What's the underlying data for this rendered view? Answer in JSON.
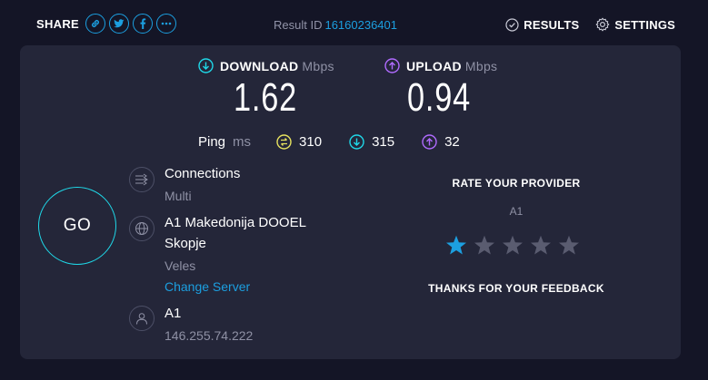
{
  "header": {
    "share_label": "SHARE",
    "share_icons": [
      "link-icon",
      "twitter-icon",
      "facebook-icon",
      "more-icon"
    ],
    "result_id_label": "Result ID",
    "result_id_value": "16160236401",
    "results_label": "RESULTS",
    "settings_label": "SETTINGS"
  },
  "download": {
    "label": "DOWNLOAD",
    "unit": "Mbps",
    "value": "1.62",
    "color": "#1fd8e8"
  },
  "upload": {
    "label": "UPLOAD",
    "unit": "Mbps",
    "value": "0.94",
    "color": "#b06bff"
  },
  "ping": {
    "label": "Ping",
    "unit": "ms",
    "idle": "310",
    "download": "315",
    "upload": "32",
    "idle_color": "#e8e35f"
  },
  "go_label": "GO",
  "connections": {
    "title": "Connections",
    "value": "Multi"
  },
  "server": {
    "name_line1": "A1 Makedonija DOOEL",
    "name_line2": "Skopje",
    "location": "Veles",
    "change_label": "Change Server"
  },
  "provider": {
    "name": "A1",
    "ip": "146.255.74.222"
  },
  "rating": {
    "title": "RATE YOUR PROVIDER",
    "isp": "A1",
    "stars_selected": 1,
    "stars_total": 5,
    "thanks": "THANKS FOR YOUR FEEDBACK",
    "star_active_color": "#1c9fe0",
    "star_inactive_color": "#5a5c70"
  },
  "colors": {
    "accent": "#1c9fe0",
    "panel": "#242639",
    "background": "#141526"
  }
}
